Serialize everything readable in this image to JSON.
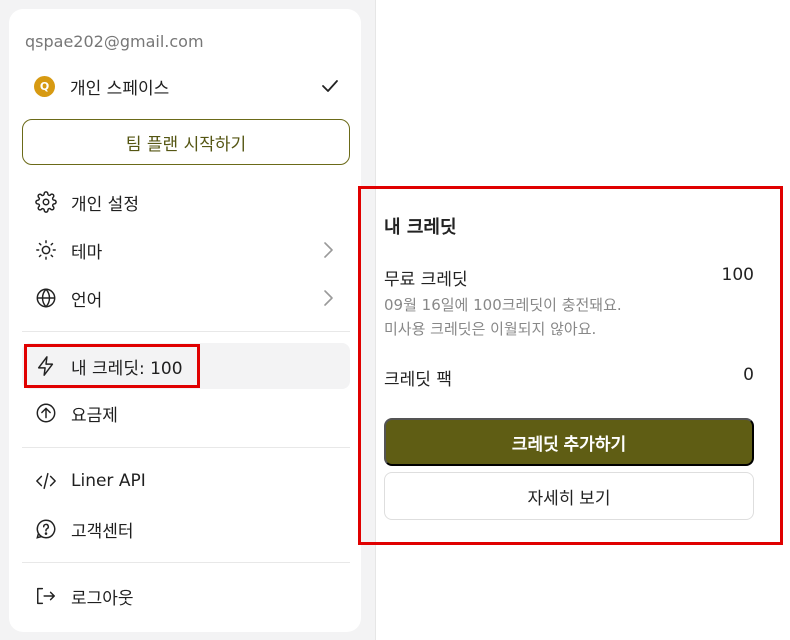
{
  "account": {
    "email": "qspae202@gmail.com",
    "avatar_letter": "Q",
    "space_label": "개인 스페이스"
  },
  "team_plan_button": "팀 플랜 시작하기",
  "menu": {
    "settings": "개인 설정",
    "theme": "테마",
    "language": "언어",
    "credits": "내 크레딧: 100",
    "pricing": "요금제",
    "api": "Liner API",
    "support": "고객센터",
    "logout": "로그아웃"
  },
  "credit_panel": {
    "title": "내 크레딧",
    "free_label": "무료 크레딧",
    "free_value": "100",
    "free_note_1": "09월 16일에 100크레딧이 충전돼요.",
    "free_note_2": "미사용 크레딧은 이월되지 않아요.",
    "pack_label": "크레딧 팩",
    "pack_value": "0",
    "add_button": "크레딧 추가하기",
    "detail_button": "자세히 보기"
  },
  "colors": {
    "accent_olive": "#5f5d14",
    "avatar_gold": "#d79a12",
    "highlight_red": "#e00000"
  },
  "icons": [
    "check-icon",
    "gear-icon",
    "sun-icon",
    "chevron-right-icon",
    "globe-icon",
    "lightning-icon",
    "arrow-up-circle-icon",
    "code-icon",
    "help-circle-icon",
    "logout-icon"
  ]
}
